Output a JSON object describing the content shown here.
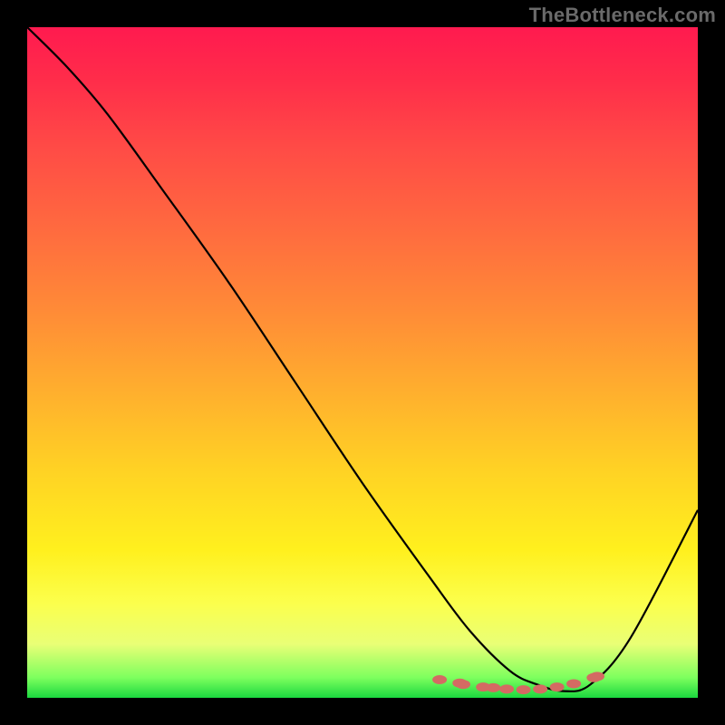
{
  "watermark": "TheBottleneck.com",
  "chart_data": {
    "type": "line",
    "title": "",
    "xlabel": "",
    "ylabel": "",
    "xlim": [
      0,
      100
    ],
    "ylim": [
      0,
      100
    ],
    "series": [
      {
        "name": "bottleneck-curve",
        "x": [
          0,
          6,
          12,
          20,
          30,
          40,
          50,
          60,
          66,
          72,
          76,
          80,
          84,
          90,
          100
        ],
        "values": [
          100,
          94,
          87,
          76,
          62,
          47,
          32,
          18,
          10,
          4,
          2,
          1,
          2,
          9,
          28
        ]
      }
    ],
    "markers": {
      "name": "highlight-dots",
      "color": "#d46a63",
      "x": [
        61.5,
        64.5,
        65.0,
        68.0,
        69.5,
        71.5,
        74.0,
        76.5,
        79.0,
        81.5,
        84.5,
        85.0
      ],
      "values": [
        2.7,
        2.2,
        2.0,
        1.6,
        1.5,
        1.3,
        1.2,
        1.3,
        1.6,
        2.1,
        3.0,
        3.2
      ]
    }
  },
  "colors": {
    "curve": "#000000",
    "marker": "#d46a63",
    "background_frame": "#000000"
  }
}
